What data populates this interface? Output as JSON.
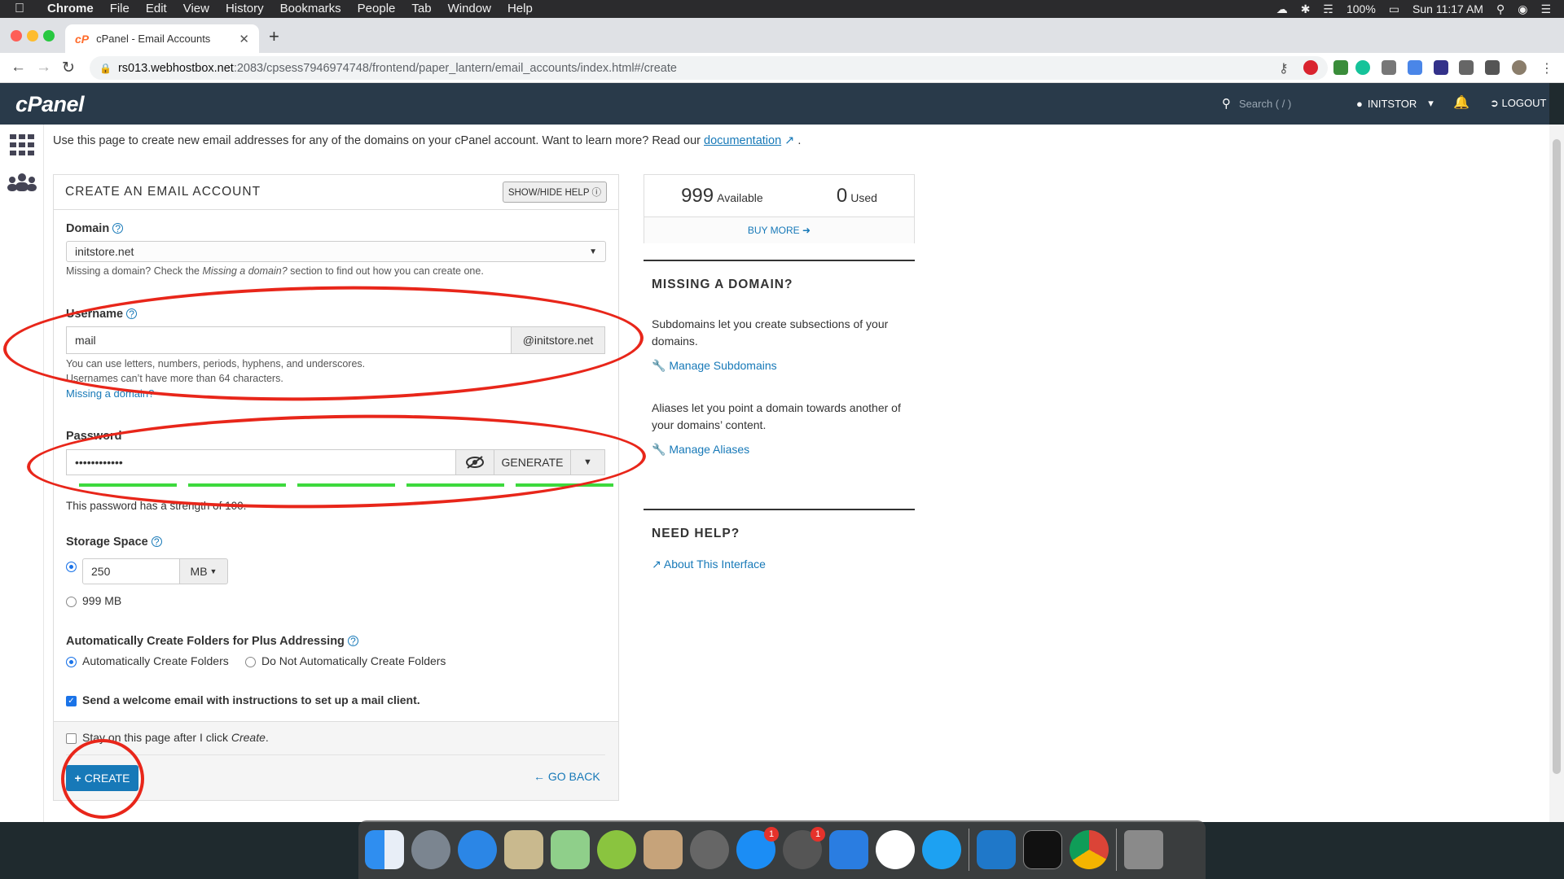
{
  "menubar": {
    "app": "Chrome",
    "items": [
      "File",
      "Edit",
      "View",
      "History",
      "Bookmarks",
      "People",
      "Tab",
      "Window",
      "Help"
    ],
    "battery": "100%",
    "clock": "Sun 11:17 AM"
  },
  "browser": {
    "tab_title": "cPanel - Email Accounts",
    "url_host": "rs013.webhostbox.net",
    "url_path": ":2083/cpsess7946974748/frontend/paper_lantern/email_accounts/index.html#/create"
  },
  "cpanel": {
    "logo": "cPanel",
    "search_placeholder": "Search ( / )",
    "user": "INITSTOR",
    "logout": "LOGOUT"
  },
  "intro": {
    "text": "Use this page to create new email addresses for any of the domains on your cPanel account. Want to learn more? Read our ",
    "link": "documentation",
    "end": " ."
  },
  "form": {
    "title": "CREATE AN EMAIL ACCOUNT",
    "help_button": "SHOW/HIDE HELP",
    "domain_label": "Domain",
    "domain_value": "initstore.net",
    "domain_hint_1": "Missing a domain? Check the ",
    "domain_hint_em": "Missing a domain?",
    "domain_hint_2": " section to find out how you can create one.",
    "username_label": "Username",
    "username_value": "mail",
    "username_suffix": "@initstore.net",
    "username_hint_1": "You can use letters, numbers, periods, hyphens, and underscores.",
    "username_hint_2": "Usernames can’t have more than 64 characters.",
    "missing_domain_link": "Missing a domain?",
    "password_label": "Password",
    "password_value": "••••••••••••",
    "generate": "GENERATE",
    "strength_text": "This password has a strength of 100.",
    "strength": 100,
    "storage_label": "Storage Space",
    "storage_value": "250",
    "storage_unit": "MB",
    "storage_alt": "999 MB",
    "plus_label": "Automatically Create Folders for Plus Addressing",
    "plus_opt_1": "Automatically Create Folders",
    "plus_opt_2": "Do Not Automatically Create Folders",
    "welcome": "Send a welcome email with instructions to set up a mail client.",
    "stay_1": "Stay on this page after I click ",
    "stay_em": "Create",
    "stay_2": ".",
    "create": "CREATE",
    "goback": "GO BACK"
  },
  "stats": {
    "available_num": "999",
    "available_lbl": "Available",
    "used_num": "0",
    "used_lbl": "Used",
    "buy_more": "BUY MORE"
  },
  "missing": {
    "title": "MISSING A DOMAIN?",
    "p1": "Subdomains let you create subsections of your domains.",
    "link1": "Manage Subdomains",
    "p2": "Aliases let you point a domain towards another of your domains’ content.",
    "link2": "Manage Aliases"
  },
  "help": {
    "title": "NEED HELP?",
    "link": "About This Interface"
  },
  "dock": {
    "badges": [
      "1",
      "1"
    ]
  },
  "colors": {
    "accent": "#1779b8",
    "header": "#293a4a",
    "annotation": "#e8261a",
    "strength": "#3dd93d"
  }
}
